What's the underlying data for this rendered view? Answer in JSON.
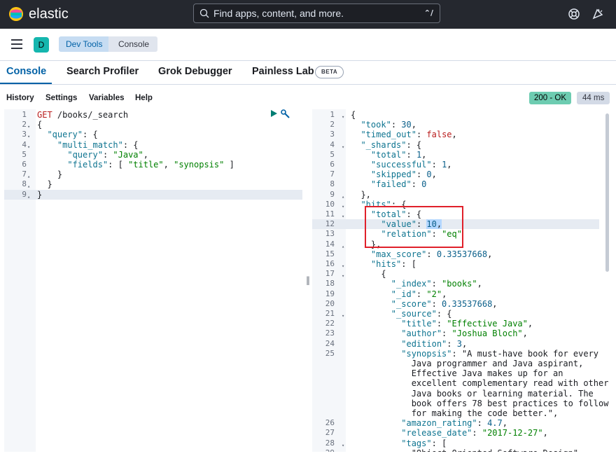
{
  "app": {
    "brand": "elastic",
    "search_placeholder": "Find apps, content, and more.",
    "search_shortcut": "⌃/"
  },
  "breadcrumbs": {
    "space_initial": "D",
    "items": [
      "Dev Tools",
      "Console"
    ]
  },
  "tabs": [
    {
      "label": "Console",
      "active": true
    },
    {
      "label": "Search Profiler"
    },
    {
      "label": "Grok Debugger"
    },
    {
      "label": "Painless Lab"
    }
  ],
  "beta_label": "BETA",
  "toolbar": {
    "items": [
      "History",
      "Settings",
      "Variables",
      "Help"
    ],
    "status": "200 - OK",
    "time": "44 ms"
  },
  "request_lines": [
    {
      "n": "1",
      "fold": "",
      "code": "GET /books/_search"
    },
    {
      "n": "2",
      "fold": "▾",
      "code": "{"
    },
    {
      "n": "3",
      "fold": "▾",
      "code": "  \"query\": {"
    },
    {
      "n": "4",
      "fold": "▾",
      "code": "    \"multi_match\": {"
    },
    {
      "n": "5",
      "fold": "",
      "code": "      \"query\": \"Java\","
    },
    {
      "n": "6",
      "fold": "",
      "code": "      \"fields\": [ \"title\", \"synopsis\" ]"
    },
    {
      "n": "7",
      "fold": "▴",
      "code": "    }"
    },
    {
      "n": "8",
      "fold": "▴",
      "code": "  }"
    },
    {
      "n": "9",
      "fold": "▴",
      "code": "}"
    }
  ],
  "response_lines": [
    {
      "n": "1",
      "fold": "▾",
      "code": "{"
    },
    {
      "n": "2",
      "fold": "",
      "code": "  \"took\": 30,"
    },
    {
      "n": "3",
      "fold": "",
      "code": "  \"timed_out\": false,"
    },
    {
      "n": "4",
      "fold": "▾",
      "code": "  \"_shards\": {"
    },
    {
      "n": "5",
      "fold": "",
      "code": "    \"total\": 1,"
    },
    {
      "n": "6",
      "fold": "",
      "code": "    \"successful\": 1,"
    },
    {
      "n": "7",
      "fold": "",
      "code": "    \"skipped\": 0,"
    },
    {
      "n": "8",
      "fold": "",
      "code": "    \"failed\": 0"
    },
    {
      "n": "9",
      "fold": "▴",
      "code": "  },"
    },
    {
      "n": "10",
      "fold": "▾",
      "code": "  \"hits\": {"
    },
    {
      "n": "11",
      "fold": "▾",
      "code": "    \"total\": {"
    },
    {
      "n": "12",
      "fold": "",
      "code": "      \"value\": 10,"
    },
    {
      "n": "13",
      "fold": "",
      "code": "      \"relation\": \"eq\""
    },
    {
      "n": "14",
      "fold": "▴",
      "code": "    },"
    },
    {
      "n": "15",
      "fold": "",
      "code": "    \"max_score\": 0.33537668,"
    },
    {
      "n": "16",
      "fold": "▾",
      "code": "    \"hits\": ["
    },
    {
      "n": "17",
      "fold": "▾",
      "code": "      {"
    },
    {
      "n": "18",
      "fold": "",
      "code": "        \"_index\": \"books\","
    },
    {
      "n": "19",
      "fold": "",
      "code": "        \"_id\": \"2\","
    },
    {
      "n": "20",
      "fold": "",
      "code": "        \"_score\": 0.33537668,"
    },
    {
      "n": "21",
      "fold": "▾",
      "code": "        \"_source\": {"
    },
    {
      "n": "22",
      "fold": "",
      "code": "          \"title\": \"Effective Java\","
    },
    {
      "n": "23",
      "fold": "",
      "code": "          \"author\": \"Joshua Bloch\","
    },
    {
      "n": "24",
      "fold": "",
      "code": "          \"edition\": 3,"
    },
    {
      "n": "25",
      "fold": "",
      "code": "          \"synopsis\": \"A must-have book for every"
    },
    {
      "n": "",
      "fold": "",
      "code": "            Java programmer and Java aspirant,"
    },
    {
      "n": "",
      "fold": "",
      "code": "            Effective Java makes up for an"
    },
    {
      "n": "",
      "fold": "",
      "code": "            excellent complementary read with other"
    },
    {
      "n": "",
      "fold": "",
      "code": "            Java books or learning material. The"
    },
    {
      "n": "",
      "fold": "",
      "code": "            book offers 78 best practices to follow"
    },
    {
      "n": "",
      "fold": "",
      "code": "            for making the code better.\","
    },
    {
      "n": "26",
      "fold": "",
      "code": "          \"amazon_rating\": 4.7,"
    },
    {
      "n": "27",
      "fold": "",
      "code": "          \"release_date\": \"2017-12-27\","
    },
    {
      "n": "28",
      "fold": "▾",
      "code": "          \"tags\": ["
    },
    {
      "n": "29",
      "fold": "",
      "code": "            \"Object Oriented Software Design\","
    }
  ],
  "colors": {
    "topbar": "#25282f",
    "accent": "#0061a6",
    "status_ok": "#6dccb1",
    "highlight": "#e0202a"
  }
}
